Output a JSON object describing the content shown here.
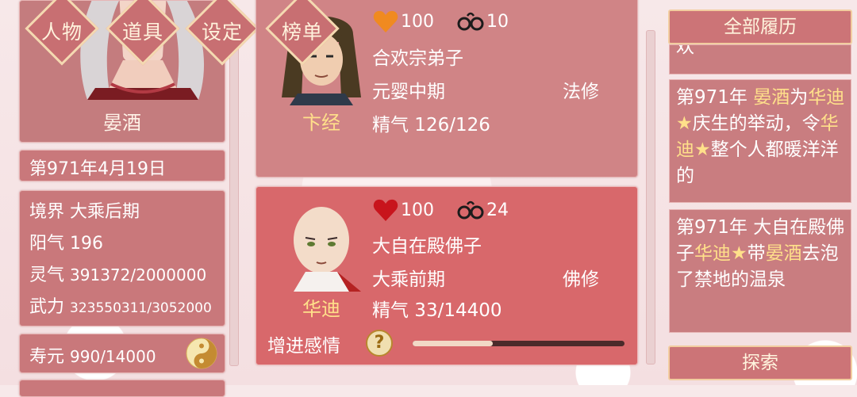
{
  "menu": {
    "character": "人物",
    "items": "道具",
    "settings": "设定",
    "ranking": "榜单"
  },
  "player": {
    "name": "晏酒",
    "date": "第971年4月19日",
    "realm_label": "境界",
    "realm_value": "大乘后期",
    "yang_label": "阳气",
    "yang_value": "196",
    "spirit_label": "灵气",
    "spirit_value": "391372/2000000",
    "force_label": "武力",
    "force_value": "323550311/3052000",
    "lifespan_label": "寿元",
    "lifespan_value": "990/14000"
  },
  "characters": [
    {
      "name": "卞经",
      "affection": "100",
      "bond": "10",
      "sect": "合欢宗弟子",
      "realm": "元婴中期",
      "type": "法修",
      "essence": "精气 126/126",
      "heart_color": "#f08a20"
    },
    {
      "name": "华迪",
      "affection": "100",
      "bond": "24",
      "sect": "大自在殿佛子",
      "realm": "大乘前期",
      "type": "佛修",
      "essence": "精气 33/14400",
      "heart_color": "#c8141c",
      "affection_action": "增进感情",
      "help": "?",
      "progress": 0.38
    }
  ],
  "history": {
    "title": "全部履历",
    "partial_top": "欢",
    "entry1": {
      "year": "第971年",
      "a": "晏酒",
      "t1": "为",
      "b": "华迪★",
      "t2": "庆生的举动，令",
      "c": "华迪★",
      "t3": "整个人都暖洋洋的"
    },
    "entry2": {
      "t0": "第971年 大自在殿佛子",
      "a": "华迪★",
      "t1": "带",
      "b": "晏酒",
      "t2": "去泡了禁地的温泉"
    }
  },
  "explore": "探索",
  "colors": {
    "panel": "#c9787b",
    "card_active": "#d8686b",
    "highlight": "#ffe08a"
  }
}
